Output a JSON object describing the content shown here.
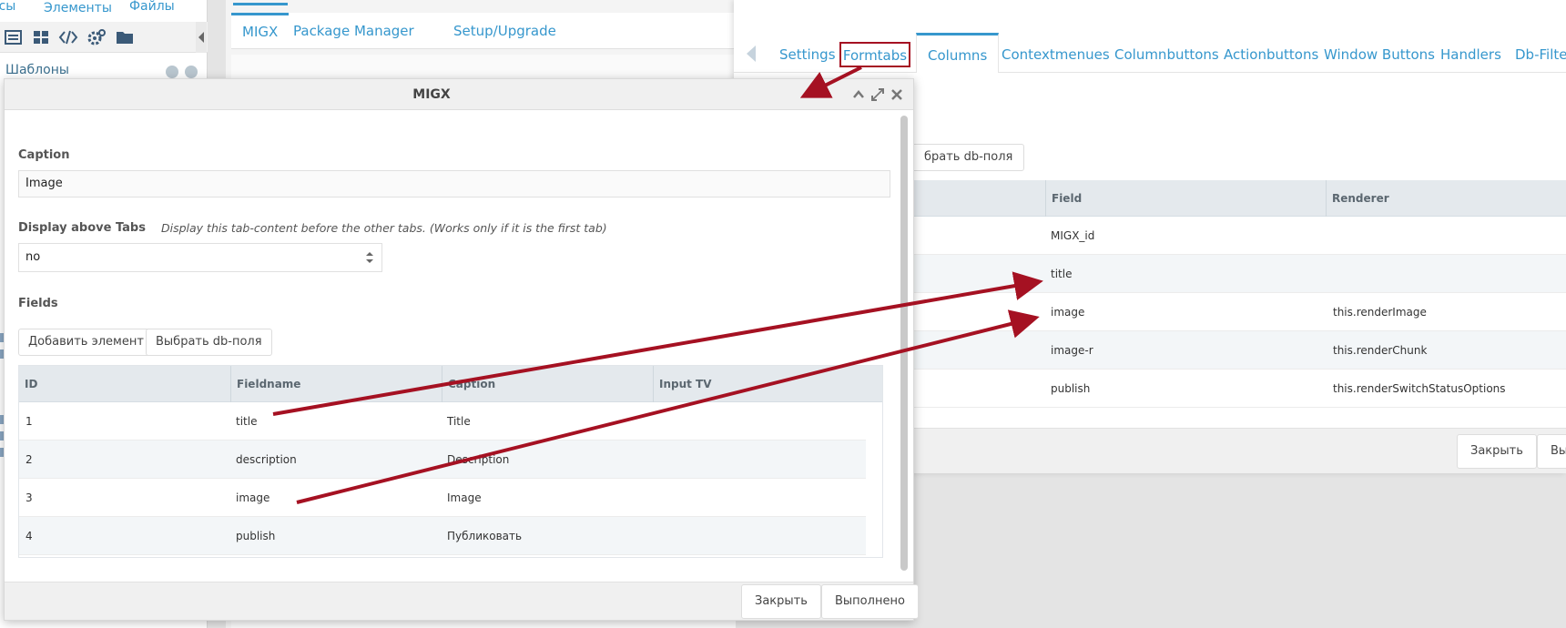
{
  "left_panel": {
    "tabs": [
      "осы",
      "Элементы",
      "Файлы"
    ],
    "toolbar_icons": [
      "list-icon",
      "grid-icon",
      "code-icon",
      "gears-icon",
      "folder-icon"
    ],
    "tree_root": "Шаблоны"
  },
  "center_panel": {
    "tabs": [
      "MIGX",
      "Package Manager",
      "Setup/Upgrade"
    ]
  },
  "right_window": {
    "tabs": [
      "Settings",
      "Formtabs",
      "Columns",
      "Contextmenues",
      "Columnbuttons",
      "Actionbuttons",
      "Window Buttons",
      "Handlers",
      "Db-Filters"
    ],
    "db_fields_button": "брать db-поля",
    "columns": [
      "Field",
      "Renderer"
    ],
    "rows": [
      {
        "field": "MIGX_id",
        "renderer": ""
      },
      {
        "field": "title",
        "renderer": ""
      },
      {
        "field": "image",
        "renderer": "this.renderImage"
      },
      {
        "field": "image-r",
        "renderer": "this.renderChunk"
      },
      {
        "field": "publish",
        "renderer": "this.renderSwitchStatusOptions"
      }
    ],
    "close_button": "Закрыть",
    "done_button": "Вы"
  },
  "modal": {
    "title": "MIGX",
    "caption_label": "Caption",
    "caption_value": "Image",
    "display_above_label": "Display above Tabs",
    "display_above_hint": "Display this tab-content before the other tabs. (Works only if it is the first tab)",
    "display_above_value": "no",
    "fields_label": "Fields",
    "add_button": "Добавить элемент",
    "pick_db_button": "Выбрать db-поля",
    "columns": [
      "ID",
      "Fieldname",
      "Caption",
      "Input TV"
    ],
    "rows": [
      {
        "id": "1",
        "fieldname": "title",
        "caption": "Title"
      },
      {
        "id": "2",
        "fieldname": "description",
        "caption": "Description"
      },
      {
        "id": "3",
        "fieldname": "image",
        "caption": "Image"
      },
      {
        "id": "4",
        "fieldname": "publish",
        "caption": "Публиковать"
      }
    ],
    "close_button": "Закрыть",
    "done_button": "Выполнено"
  },
  "colors": {
    "accent": "#3697cd",
    "annotation": "#a51122"
  }
}
